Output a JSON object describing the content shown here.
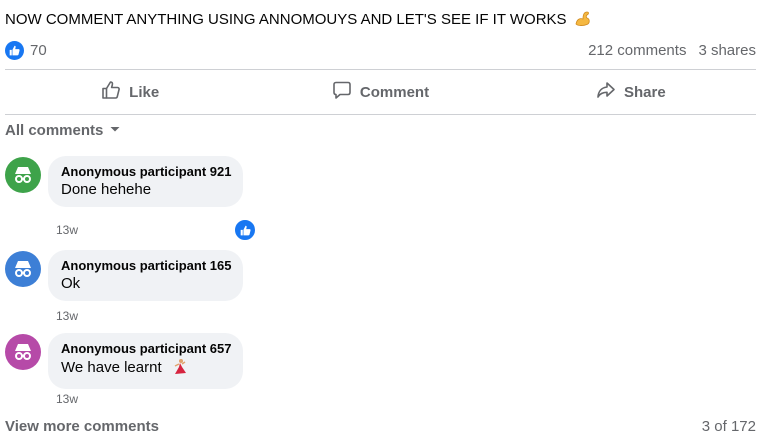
{
  "post": {
    "text": "NOW COMMENT ANYTHING USING ANNOMOUYS AND LET'S SEE IF IT WORKS",
    "emoji": "flexed-biceps"
  },
  "stats": {
    "reaction_count": "70",
    "comments": "212 comments",
    "shares": "3 shares"
  },
  "actions": {
    "like": "Like",
    "comment": "Comment",
    "share": "Share"
  },
  "comments_filter": "All comments",
  "comments": [
    {
      "author": "Anonymous participant 921",
      "text": "Done hehehe",
      "time": "13w",
      "avatar_color": "#3ea34a",
      "liked": true
    },
    {
      "author": "Anonymous participant 165",
      "text": "Ok",
      "time": "13w",
      "avatar_color": "#3d7fd6",
      "liked": false
    },
    {
      "author": "Anonymous participant 657",
      "text": "We have learnt",
      "time": "13w",
      "avatar_color": "#b64aa8",
      "liked": false,
      "emoji": "dancing-woman"
    }
  ],
  "footer": {
    "view_more": "View more comments",
    "pagination": "3 of 172"
  },
  "colors": {
    "brand_blue": "#1877f2",
    "secondary_text": "#65676b",
    "bubble_bg": "#f0f2f5"
  }
}
